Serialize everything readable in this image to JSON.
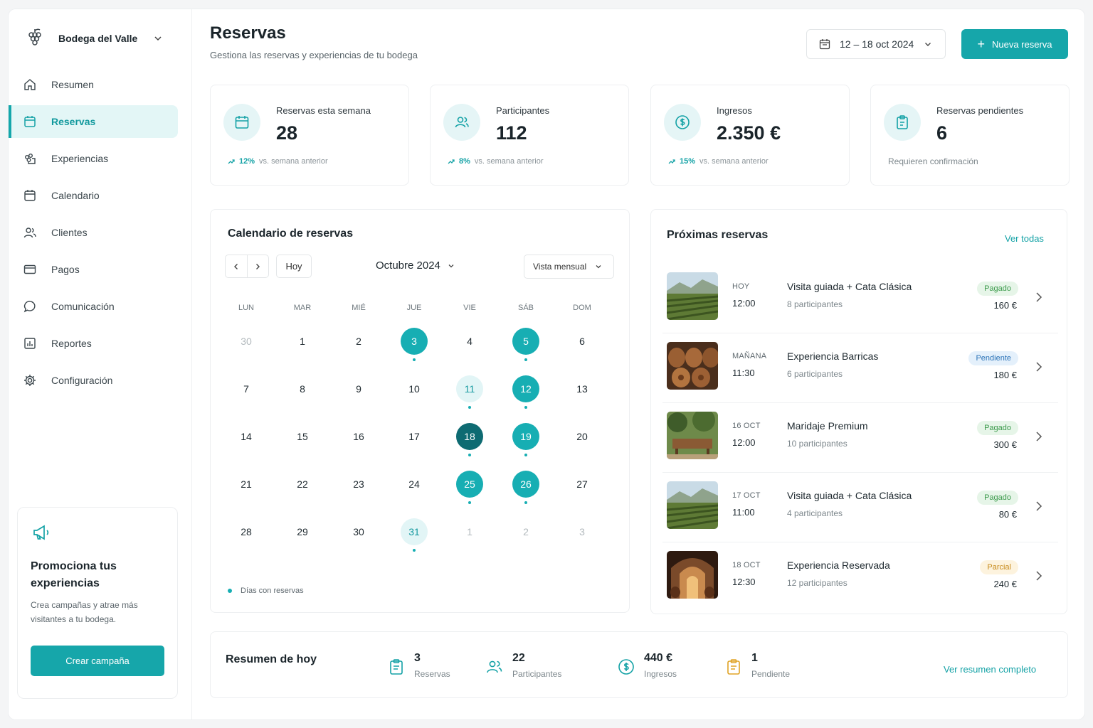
{
  "brand": {
    "name": "Bodega del Valle"
  },
  "nav": [
    {
      "label": "Resumen",
      "icon": "home-icon"
    },
    {
      "label": "Reservas",
      "icon": "calendar-icon",
      "active": true
    },
    {
      "label": "Experiencias",
      "icon": "grapes-icon"
    },
    {
      "label": "Calendario",
      "icon": "calendar-icon"
    },
    {
      "label": "Clientes",
      "icon": "users-icon"
    },
    {
      "label": "Pagos",
      "icon": "card-icon"
    },
    {
      "label": "Comunicación",
      "icon": "chat-icon"
    },
    {
      "label": "Reportes",
      "icon": "chart-icon"
    },
    {
      "label": "Configuración",
      "icon": "gear-icon"
    }
  ],
  "promo": {
    "title": "Promociona tus experiencias",
    "text": "Crea campañas y atrae más visitantes a tu bodega.",
    "button": "Crear campaña"
  },
  "header": {
    "title": "Reservas",
    "subtitle": "Gestiona las reservas y experiencias de tu bodega",
    "date_range": "12 – 18 oct 2024",
    "new_button": "Nueva reserva"
  },
  "stats": [
    {
      "label": "Reservas esta semana",
      "value": "28",
      "pct": "12%",
      "trend": "vs. semana anterior"
    },
    {
      "label": "Participantes",
      "value": "112",
      "pct": "8%",
      "trend": "vs. semana anterior"
    },
    {
      "label": "Ingresos",
      "value": "2.350 €",
      "pct": "15%",
      "trend": "vs. semana anterior"
    },
    {
      "label": "Reservas pendientes",
      "value": "6",
      "note": "Requieren confirmación"
    }
  ],
  "calendar": {
    "title": "Calendario de reservas",
    "today_label": "Hoy",
    "month": "Octubre 2024",
    "view": "Vista mensual",
    "weekdays": [
      "LUN",
      "MAR",
      "MIÉ",
      "JUE",
      "VIE",
      "SÁB",
      "DOM"
    ],
    "weeks": [
      [
        {
          "d": "30",
          "s": "muted"
        },
        {
          "d": "1"
        },
        {
          "d": "2"
        },
        {
          "d": "3",
          "s": "teal",
          "dot": true
        },
        {
          "d": "4"
        },
        {
          "d": "5",
          "s": "teal",
          "dot": true
        },
        {
          "d": "6"
        }
      ],
      [
        {
          "d": "7"
        },
        {
          "d": "8"
        },
        {
          "d": "9"
        },
        {
          "d": "10"
        },
        {
          "d": "11",
          "s": "light",
          "dot": true
        },
        {
          "d": "12",
          "s": "teal",
          "dot": true
        },
        {
          "d": "13"
        }
      ],
      [
        {
          "d": "14"
        },
        {
          "d": "15"
        },
        {
          "d": "16"
        },
        {
          "d": "17"
        },
        {
          "d": "18",
          "s": "dark",
          "dot": true
        },
        {
          "d": "19",
          "s": "teal",
          "dot": true
        },
        {
          "d": "20"
        }
      ],
      [
        {
          "d": "21"
        },
        {
          "d": "22"
        },
        {
          "d": "23"
        },
        {
          "d": "24"
        },
        {
          "d": "25",
          "s": "teal",
          "dot": true
        },
        {
          "d": "26",
          "s": "teal",
          "dot": true
        },
        {
          "d": "27"
        }
      ],
      [
        {
          "d": "28"
        },
        {
          "d": "29"
        },
        {
          "d": "30"
        },
        {
          "d": "31",
          "s": "light",
          "dot": true
        },
        {
          "d": "1",
          "s": "muted"
        },
        {
          "d": "2",
          "s": "muted"
        },
        {
          "d": "3",
          "s": "muted"
        }
      ]
    ],
    "legend": "Días con reservas"
  },
  "upcoming": {
    "title": "Próximas reservas",
    "view_all": "Ver todas",
    "items": [
      {
        "when": "HOY",
        "time": "12:00",
        "title": "Visita guiada + Cata Clásica",
        "parts": "8 participantes",
        "status": "Pagado",
        "kind": "paid",
        "price": "160 €",
        "img": "vineyard"
      },
      {
        "when": "MAÑANA",
        "time": "11:30",
        "title": "Experiencia Barricas",
        "parts": "6 participantes",
        "status": "Pendiente",
        "kind": "pend",
        "price": "180 €",
        "img": "barrels"
      },
      {
        "when": "16 OCT",
        "time": "12:00",
        "title": "Maridaje Premium",
        "parts": "10 participantes",
        "status": "Pagado",
        "kind": "paid",
        "price": "300 €",
        "img": "terrace"
      },
      {
        "when": "17 OCT",
        "time": "11:00",
        "title": "Visita guiada + Cata Clásica",
        "parts": "4 participantes",
        "status": "Pagado",
        "kind": "paid",
        "price": "80 €",
        "img": "vineyard"
      },
      {
        "when": "18 OCT",
        "time": "12:30",
        "title": "Experiencia Reservada",
        "parts": "12 participantes",
        "status": "Parcial",
        "kind": "part",
        "price": "240 €",
        "img": "cellar"
      }
    ]
  },
  "today_summary": {
    "title": "Resumen de hoy",
    "stats": [
      {
        "value": "3",
        "label": "Reservas",
        "icon": "clipboard-icon"
      },
      {
        "value": "22",
        "label": "Participantes",
        "icon": "users-icon"
      },
      {
        "value": "440 €",
        "label": "Ingresos",
        "icon": "dollar-icon"
      },
      {
        "value": "1",
        "label": "Pendiente",
        "icon": "clipboard-pending-icon"
      }
    ],
    "more": "Ver resumen completo"
  },
  "colors": {
    "accent": "#16a6aa",
    "accent_dark": "#0e6b72",
    "accent_light": "#e2f5f6"
  }
}
